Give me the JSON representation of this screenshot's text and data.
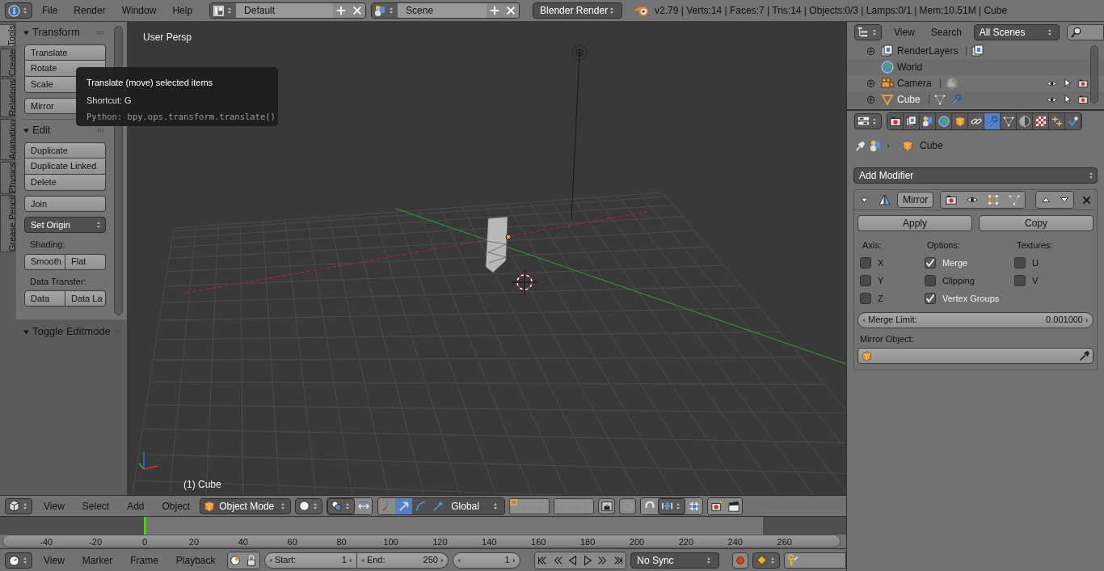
{
  "top_bar": {
    "menus": [
      "File",
      "Render",
      "Window",
      "Help"
    ],
    "screen_layout": "Default",
    "scene": "Scene",
    "render_engine": "Blender Render",
    "stats": "v2.79 | Verts:14 | Faces:7 | Tris:14 | Objects:0/3 | Lamps:0/1 | Mem:10.51M | Cube"
  },
  "tool_tabs": [
    {
      "label": "Tools",
      "selected": true
    },
    {
      "label": "Create",
      "selected": false
    },
    {
      "label": "Relations",
      "selected": false
    },
    {
      "label": "Animation",
      "selected": false
    },
    {
      "label": "Physics",
      "selected": false
    },
    {
      "label": "Grease Pencil",
      "selected": false
    }
  ],
  "tool_shelf": {
    "panels": [
      {
        "title": "Transform",
        "expanded": true,
        "items": [
          {
            "kind": "stack",
            "labels": [
              "Translate",
              "Rotate",
              "Scale"
            ]
          },
          {
            "kind": "button",
            "label": "Mirror"
          }
        ]
      },
      {
        "title": "Edit",
        "expanded": true,
        "items": [
          {
            "kind": "stack",
            "labels": [
              "Duplicate",
              "Duplicate Linked",
              "Delete"
            ]
          },
          {
            "kind": "button",
            "label": "Join"
          },
          {
            "kind": "dropdown",
            "label": "Set Origin"
          },
          {
            "kind": "heading",
            "label": "Shading:"
          },
          {
            "kind": "row",
            "labels": [
              "Smooth",
              "Flat"
            ]
          },
          {
            "kind": "heading",
            "label": "Data Transfer:"
          },
          {
            "kind": "row",
            "labels": [
              "Data",
              "Data La"
            ]
          }
        ]
      }
    ],
    "operator_panel": {
      "title": "Toggle Editmode",
      "expanded": true
    }
  },
  "tooltip": {
    "title": "Translate (move) selected items",
    "shortcut": "Shortcut: G",
    "python": "Python: bpy.ops.transform.translate()"
  },
  "viewport": {
    "view_name": "User Persp",
    "object_label": "(1) Cube"
  },
  "viewport_header": {
    "menus": [
      "View",
      "Select",
      "Add",
      "Object"
    ],
    "mode": "Object Mode",
    "orientation": "Global"
  },
  "timeline": {
    "ticks": [
      "-40",
      "-20",
      "0",
      "20",
      "40",
      "60",
      "80",
      "100",
      "120",
      "140",
      "160",
      "180",
      "200",
      "220",
      "240",
      "260"
    ]
  },
  "timeline_header": {
    "menus": [
      "View",
      "Marker",
      "Frame",
      "Playback"
    ],
    "start_label": "Start:",
    "start": "1",
    "end_label": "End:",
    "end": "250",
    "current_frame": "1",
    "sync": "No Sync"
  },
  "outliner": {
    "menus": [
      "View",
      "Search"
    ],
    "filter": "All Scenes",
    "items": [
      {
        "kind": "renderlayers",
        "label": "RenderLayers",
        "expandable": true
      },
      {
        "kind": "world",
        "label": "World",
        "expandable": false
      },
      {
        "kind": "camera",
        "label": "Camera",
        "expandable": true
      },
      {
        "kind": "mesh",
        "label": "Cube",
        "expandable": true
      }
    ]
  },
  "properties": {
    "tabs": [
      {
        "kind": "render",
        "selected": false
      },
      {
        "kind": "render-layers",
        "selected": false
      },
      {
        "kind": "scene",
        "selected": false
      },
      {
        "kind": "world",
        "selected": false
      },
      {
        "kind": "object",
        "selected": false
      },
      {
        "kind": "constraints",
        "selected": false
      },
      {
        "kind": "modifiers",
        "selected": true
      },
      {
        "kind": "data",
        "selected": false
      },
      {
        "kind": "material",
        "selected": false
      },
      {
        "kind": "texture",
        "selected": false
      },
      {
        "kind": "particles",
        "selected": false
      },
      {
        "kind": "physics",
        "selected": false
      }
    ],
    "context": "Cube",
    "add_modifier": "Add Modifier",
    "modifier": {
      "name": "Mirror",
      "expanded": true,
      "apply": "Apply",
      "copy": "Copy",
      "columns": [
        {
          "heading": "Axis:",
          "options": [
            {
              "label": "X",
              "checked": false
            },
            {
              "label": "Y",
              "checked": false
            },
            {
              "label": "Z",
              "checked": false
            }
          ]
        },
        {
          "heading": "Options:",
          "options": [
            {
              "label": "Merge",
              "checked": true
            },
            {
              "label": "Clipping",
              "checked": false
            },
            {
              "label": "Vertex Groups",
              "checked": true
            }
          ]
        },
        {
          "heading": "Textures:",
          "options": [
            {
              "label": "U",
              "checked": false
            },
            {
              "label": "V",
              "checked": false
            }
          ]
        }
      ],
      "merge_limit_label": "Merge Limit:",
      "merge_limit": "0.001000",
      "mirror_object_label": "Mirror Object:"
    }
  }
}
